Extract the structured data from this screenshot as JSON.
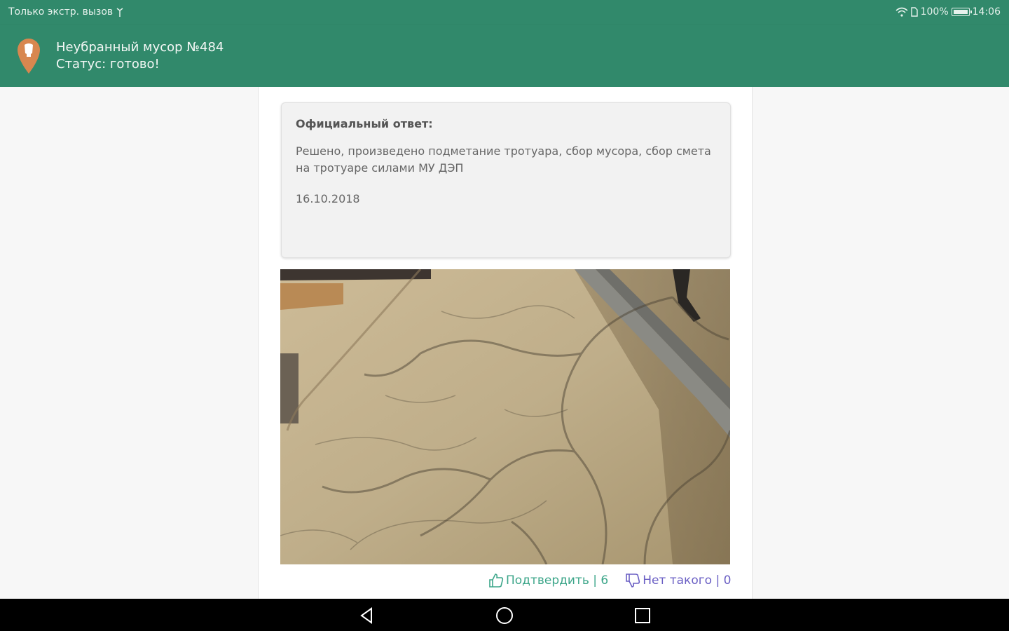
{
  "status_bar": {
    "left_text": "Только экстр. вызов",
    "battery": "100%",
    "time": "14:06"
  },
  "app_bar": {
    "title": "Неубранный мусор №484",
    "subtitle": "Статус: готово!",
    "icon": "map-pin-icon",
    "colors": {
      "background": "#31896b",
      "pin": "#d8874f"
    }
  },
  "official_answer": {
    "heading": "Официальный ответ:",
    "text": "Решено, произведено подметание тротуара, сбор мусора, сбор смета на тротуаре силами МУ ДЭП",
    "date": "16.10.2018"
  },
  "votes": {
    "confirm_label": "Подтвердить | 6",
    "deny_label": "Нет такого | 0",
    "confirm_icon": "thumbs-up-icon",
    "deny_icon": "thumbs-down-icon"
  },
  "nav_bar": {
    "back_icon": "back-triangle-icon",
    "home_icon": "home-circle-icon",
    "recents_icon": "recents-square-icon"
  }
}
